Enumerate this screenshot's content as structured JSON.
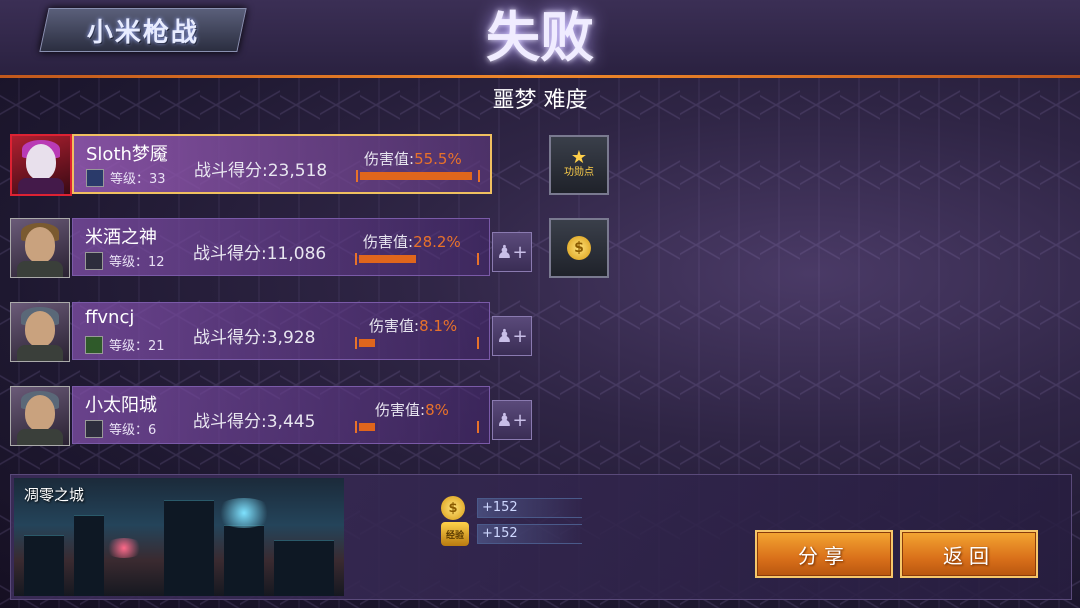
{
  "header": {
    "logo_text": "小米枪战",
    "result_title": "失败",
    "difficulty": "噩梦 难度"
  },
  "players": [
    {
      "name": "Sloth梦魇",
      "level_label": "等级：33",
      "score_label": "战斗得分:23,518",
      "damage_label": "伤害值:",
      "damage_pct": "55.5%",
      "damage_value": 55.5,
      "is_self": true
    },
    {
      "name": "米酒之神",
      "level_label": "等级：12",
      "score_label": "战斗得分:11,086",
      "damage_label": "伤害值:",
      "damage_pct": "28.2%",
      "damage_value": 28.2,
      "is_self": false
    },
    {
      "name": "ffvncj",
      "level_label": "等级：21",
      "score_label": "战斗得分:3,928",
      "damage_label": "伤害值:",
      "damage_pct": "8.1%",
      "damage_value": 8.1,
      "is_self": false
    },
    {
      "name": "小太阳城",
      "level_label": "等级：6",
      "score_label": "战斗得分:3,445",
      "damage_label": "伤害值:",
      "damage_pct": "8%",
      "damage_value": 8,
      "is_self": false
    }
  ],
  "awards": {
    "merit_label": "功勋点",
    "gold_symbol": "$"
  },
  "map": {
    "name": "凋零之城"
  },
  "rewards": {
    "gold": "+152",
    "exp": "+152",
    "exp_icon_label": "经验"
  },
  "buttons": {
    "share": "分享",
    "back": "返回"
  },
  "colors": {
    "accent_orange": "#e8722a",
    "self_border": "#f0c060"
  }
}
